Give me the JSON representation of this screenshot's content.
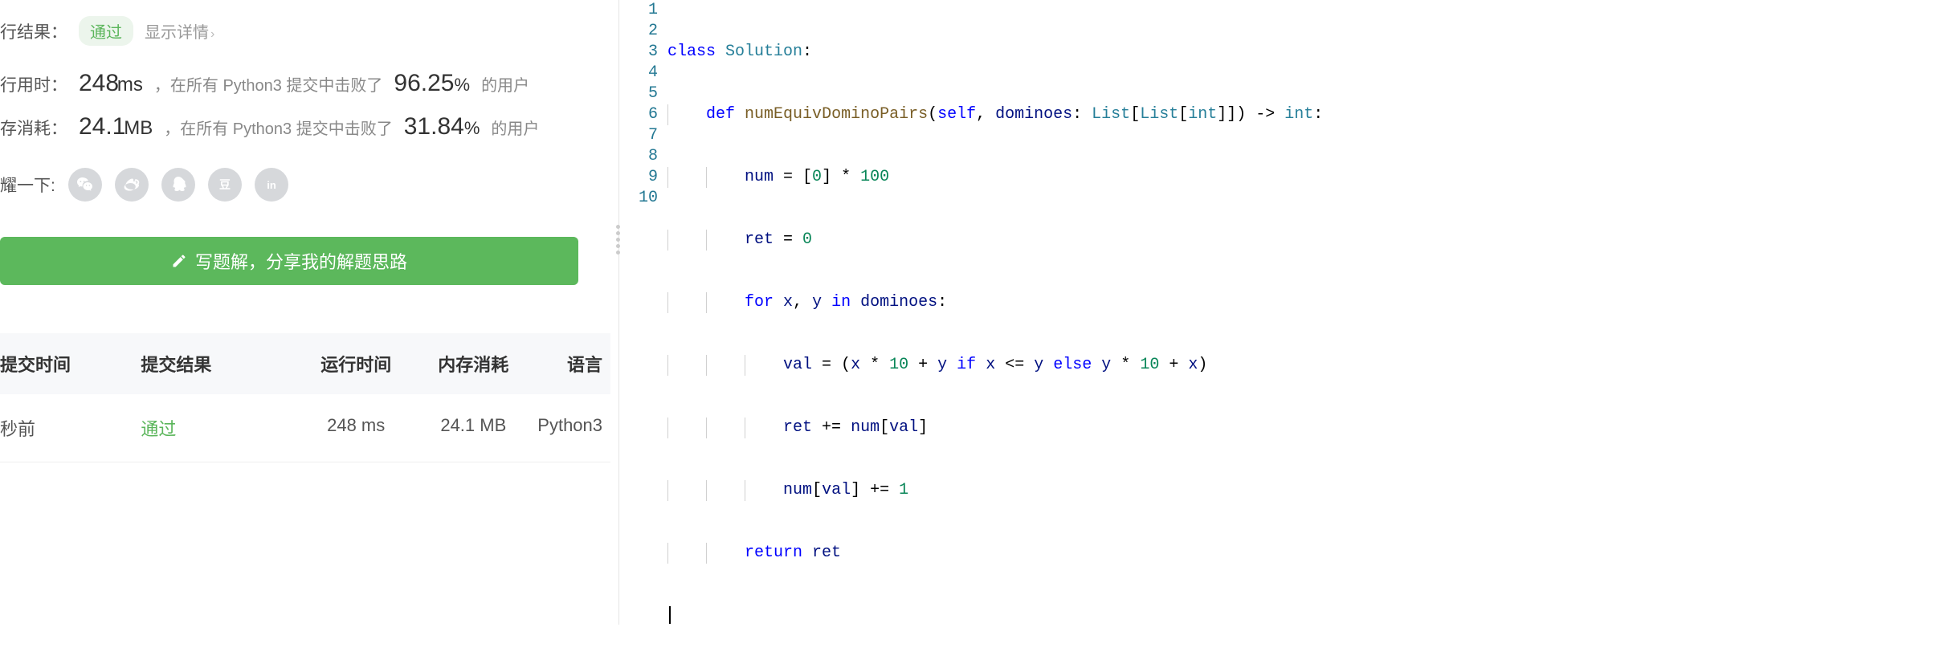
{
  "result": {
    "label": "行结果：",
    "status": "通过",
    "show_details": "显示详情",
    "runtime_label": "行用时：",
    "runtime_value": "248",
    "runtime_unit": "ms",
    "runtime_desc1": "，在所有 Python3 提交中击败了",
    "runtime_percent": "96.25",
    "runtime_desc2": "的用户",
    "memory_label": "存消耗：",
    "memory_value": "24.1",
    "memory_unit": "MB",
    "memory_desc1": "，在所有 Python3 提交中击败了",
    "memory_percent": "31.84",
    "memory_desc2": "的用户",
    "share_label": "耀一下:"
  },
  "write_solution": "写题解，分享我的解题思路",
  "table": {
    "headers": {
      "time": "提交时间",
      "result": "提交结果",
      "runtime": "运行时间",
      "memory": "内存消耗",
      "lang": "语言"
    },
    "row": {
      "time": "秒前",
      "result": "通过",
      "runtime": "248 ms",
      "memory": "24.1 MB",
      "lang": "Python3"
    }
  },
  "code": {
    "lines": [
      {
        "n": "1"
      },
      {
        "n": "2"
      },
      {
        "n": "3"
      },
      {
        "n": "4"
      },
      {
        "n": "5"
      },
      {
        "n": "6"
      },
      {
        "n": "7"
      },
      {
        "n": "8"
      },
      {
        "n": "9"
      },
      {
        "n": "10"
      }
    ],
    "tokens": {
      "class": "class",
      "solution": "Solution",
      "def": "def",
      "fnname": "numEquivDominoPairs",
      "self": "self",
      "dominoes": "dominoes",
      "list": "List",
      "int": "int",
      "num": "num",
      "ret": "ret",
      "for": "for",
      "x": "x",
      "y": "y",
      "in": "in",
      "val": "val",
      "if": "if",
      "else": "else",
      "return": "return",
      "n0": "0",
      "n1": "1",
      "n10": "10",
      "n100": "100"
    }
  }
}
